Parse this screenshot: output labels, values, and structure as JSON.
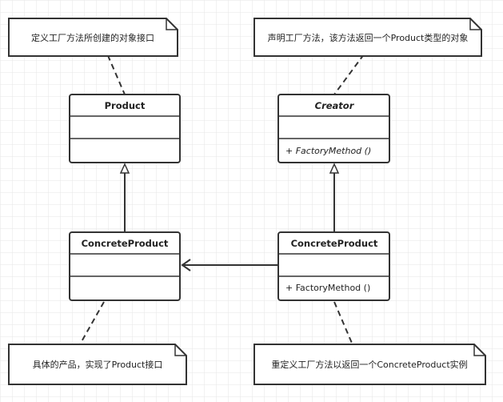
{
  "notes": {
    "product_note": "定义工厂方法所创建的对象接口",
    "creator_note": "声明工厂方法，该方法返回一个Product类型的对象",
    "concrete_product_note": "具体的产品，实现了Product接口",
    "concrete_creator_note": "重定义工厂方法以返回一个ConcreteProduct实例"
  },
  "classes": {
    "product": {
      "name": "Product"
    },
    "creator": {
      "name": "Creator",
      "method": "+ FactoryMethod ()"
    },
    "concrete_product": {
      "name": "ConcreteProduct"
    },
    "concrete_creator": {
      "name": "ConcreteProduct",
      "method": "+ FactoryMethod ()"
    }
  },
  "colors": {
    "stroke": "#333333",
    "grid": "#e6e6e6",
    "background": "#ffffff"
  }
}
